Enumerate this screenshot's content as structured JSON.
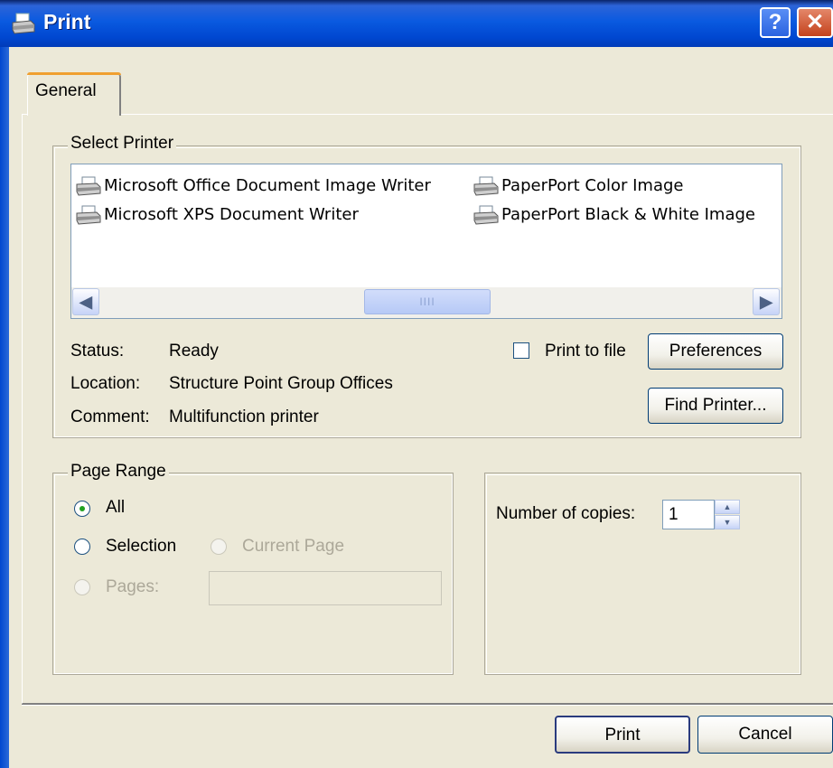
{
  "window": {
    "title": "Print",
    "help_label": "?",
    "close_label": "✕"
  },
  "tabs": [
    {
      "label": "General"
    }
  ],
  "select_printer": {
    "legend": "Select Printer",
    "printers": [
      {
        "name": "Microsoft Office Document Image Writer"
      },
      {
        "name": "Microsoft XPS Document Writer"
      },
      {
        "name": "PaperPort Color Image"
      },
      {
        "name": "PaperPort Black & White Image"
      }
    ],
    "scroll_left": "◀",
    "scroll_right": "▶",
    "scroll_grip": "IIII",
    "status_label": "Status:",
    "status_value": "Ready",
    "location_label": "Location:",
    "location_value": "Structure Point Group Offices",
    "comment_label": "Comment:",
    "comment_value": "Multifunction printer",
    "print_to_file_label": "Print to file",
    "print_to_file_checked": false,
    "preferences_label": "Preferences",
    "find_printer_label": "Find Printer..."
  },
  "page_range": {
    "legend": "Page Range",
    "all_label": "All",
    "selection_label": "Selection",
    "current_page_label": "Current Page",
    "pages_label": "Pages:",
    "pages_value": "",
    "selected": "All"
  },
  "copies": {
    "label": "Number of copies:",
    "value": "1",
    "spin_up": "▲",
    "spin_down": "▼"
  },
  "buttons": {
    "print_label": "Print",
    "cancel_label": "Cancel"
  },
  "colors": {
    "title_bar": "#0a5ae0",
    "dialog_bg": "#ece9d8",
    "accent_tab": "#f0a030"
  }
}
